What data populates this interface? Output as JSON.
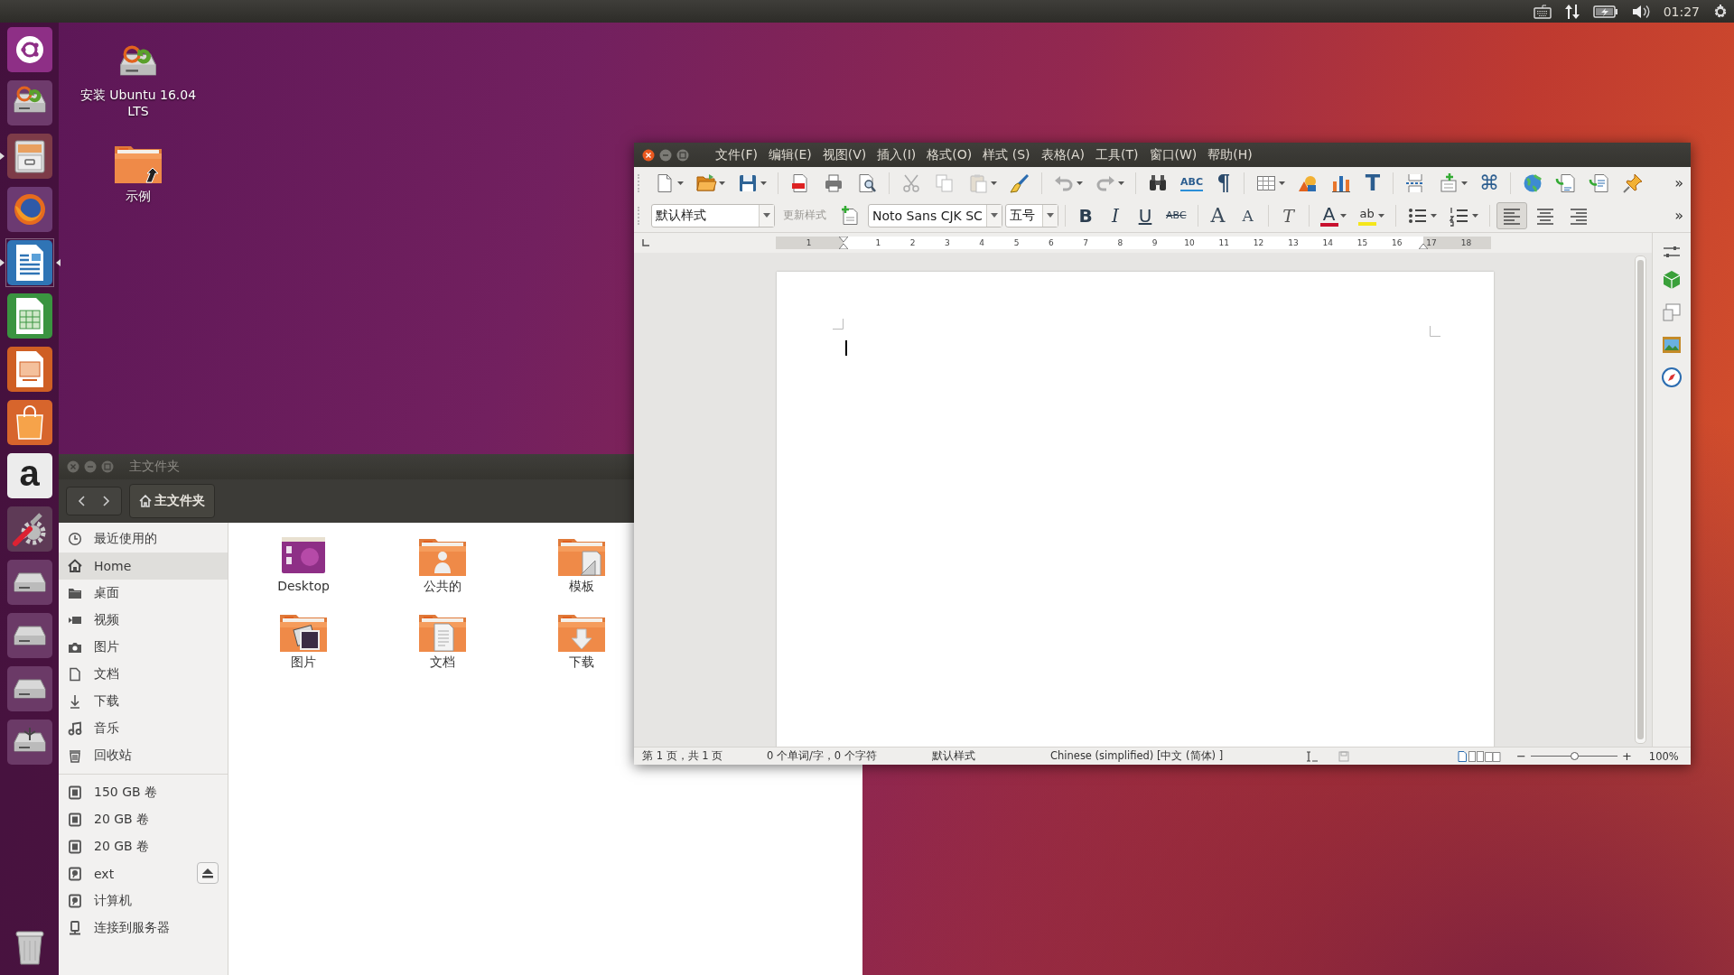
{
  "top_panel": {
    "clock": "01:27"
  },
  "launcher": {
    "items": [
      {
        "kind": "dash",
        "running": false,
        "focused": false
      },
      {
        "kind": "installer",
        "running": false,
        "focused": false
      },
      {
        "kind": "files",
        "running": true,
        "focused": false
      },
      {
        "kind": "browser",
        "running": false,
        "focused": false
      },
      {
        "kind": "writer",
        "running": true,
        "focused": true
      },
      {
        "kind": "calc",
        "running": false,
        "focused": false
      },
      {
        "kind": "impress",
        "running": false,
        "focused": false
      },
      {
        "kind": "software",
        "running": false,
        "focused": false
      },
      {
        "kind": "store",
        "glyph": "a",
        "running": false,
        "focused": false
      },
      {
        "kind": "settings",
        "running": false,
        "focused": false
      },
      {
        "kind": "drive",
        "running": false,
        "focused": false
      },
      {
        "kind": "drive",
        "running": false,
        "focused": false
      },
      {
        "kind": "drive",
        "running": false,
        "focused": false
      },
      {
        "kind": "usb-drive",
        "running": false,
        "focused": false
      },
      {
        "kind": "trash",
        "running": false,
        "focused": false
      }
    ]
  },
  "desktop_icons": [
    {
      "kind": "installer",
      "label": "安装 Ubuntu 16.04 LTS"
    },
    {
      "kind": "folder-link",
      "label": "示例"
    }
  ],
  "file_manager": {
    "title": "主文件夹",
    "path_button": "主文件夹",
    "places": [
      {
        "kind": "clock",
        "label": "最近使用的",
        "selected": false
      },
      {
        "kind": "home",
        "label": "Home",
        "selected": true
      },
      {
        "kind": "folder",
        "label": "桌面",
        "selected": false
      },
      {
        "kind": "video",
        "label": "视频",
        "selected": false
      },
      {
        "kind": "camera",
        "label": "图片",
        "selected": false
      },
      {
        "kind": "document",
        "label": "文档",
        "selected": false
      },
      {
        "kind": "download",
        "label": "下载",
        "selected": false
      },
      {
        "kind": "music",
        "label": "音乐",
        "selected": false
      },
      {
        "kind": "trash",
        "label": "回收站",
        "selected": false
      }
    ],
    "devices": [
      {
        "kind": "drive",
        "label": "150 GB 卷",
        "eject": false
      },
      {
        "kind": "drive",
        "label": "20 GB 卷",
        "eject": false
      },
      {
        "kind": "drive",
        "label": "20 GB 卷",
        "eject": false
      },
      {
        "kind": "disk",
        "label": "ext",
        "eject": true
      },
      {
        "kind": "disk",
        "label": "计算机",
        "eject": false
      },
      {
        "kind": "server",
        "label": "连接到服务器",
        "eject": false
      }
    ],
    "files": [
      {
        "kind": "desktop",
        "label": "Desktop"
      },
      {
        "kind": "public",
        "label": "公共的"
      },
      {
        "kind": "templates",
        "label": "模板"
      },
      {
        "kind": "pictures",
        "label": "图片"
      },
      {
        "kind": "documents",
        "label": "文档"
      },
      {
        "kind": "downloads",
        "label": "下载"
      }
    ]
  },
  "writer": {
    "menu": [
      "文件(F)",
      "编辑(E)",
      "视图(V)",
      "插入(I)",
      "格式(O)",
      "样式 (S)",
      "表格(A)",
      "工具(T)",
      "窗口(W)",
      "帮助(H)"
    ],
    "toolbar1": [
      {
        "kind": "new",
        "dropdown": true
      },
      {
        "kind": "open",
        "dropdown": true
      },
      {
        "kind": "save",
        "dropdown": true
      },
      {
        "kind": "separator"
      },
      {
        "kind": "pdf",
        "dropdown": false
      },
      {
        "kind": "print",
        "dropdown": false
      },
      {
        "kind": "preview",
        "dropdown": false
      },
      {
        "kind": "separator"
      },
      {
        "kind": "cut",
        "dropdown": false
      },
      {
        "kind": "copy",
        "dropdown": false
      },
      {
        "kind": "paste",
        "dropdown": true
      },
      {
        "kind": "clone",
        "dropdown": false
      },
      {
        "kind": "separator"
      },
      {
        "kind": "undo",
        "dropdown": true
      },
      {
        "kind": "redo",
        "dropdown": true
      },
      {
        "kind": "separator"
      },
      {
        "kind": "find",
        "dropdown": false
      },
      {
        "kind": "spell",
        "glyph": "ABC",
        "dropdown": false
      },
      {
        "kind": "marks",
        "glyph": "¶",
        "dropdown": false
      },
      {
        "kind": "separator"
      },
      {
        "kind": "table",
        "dropdown": true
      },
      {
        "kind": "shapes",
        "dropdown": false
      },
      {
        "kind": "chart",
        "dropdown": false
      },
      {
        "kind": "textbox",
        "glyph": "T",
        "dropdown": false
      },
      {
        "kind": "separator"
      },
      {
        "kind": "pagebreak",
        "dropdown": false
      },
      {
        "kind": "field",
        "dropdown": true
      },
      {
        "kind": "special",
        "glyph": "⌘",
        "dropdown": false
      },
      {
        "kind": "separator"
      },
      {
        "kind": "hyperlink",
        "dropdown": false
      },
      {
        "kind": "footnote",
        "dropdown": false
      },
      {
        "kind": "comment",
        "dropdown": false
      },
      {
        "kind": "track",
        "dropdown": false
      }
    ],
    "toolbar2": [
      {
        "kind": "style-combo",
        "value": "默认样式"
      },
      {
        "kind": "update-style",
        "label": "更新样式",
        "disabled": true
      },
      {
        "kind": "newstyle",
        "dropdown": false
      },
      {
        "kind": "font-combo",
        "value": "Noto Sans CJK SC"
      },
      {
        "kind": "size-combo",
        "value": "五号"
      },
      {
        "kind": "separator"
      },
      {
        "kind": "bold",
        "glyph": "B",
        "dropdown": false
      },
      {
        "kind": "italic",
        "glyph": "I",
        "dropdown": false
      },
      {
        "kind": "underline",
        "glyph": "U",
        "dropdown": false
      },
      {
        "kind": "strike",
        "glyph": "ABC",
        "dropdown": false
      },
      {
        "kind": "separator"
      },
      {
        "kind": "grow",
        "glyph": "A",
        "dropdown": false
      },
      {
        "kind": "shrink",
        "glyph": "A",
        "dropdown": false
      },
      {
        "kind": "separator"
      },
      {
        "kind": "clear",
        "glyph": "T",
        "dropdown": false
      },
      {
        "kind": "separator"
      },
      {
        "kind": "fontcolor",
        "glyph": "A",
        "dropdown": true
      },
      {
        "kind": "highlight",
        "glyph": "ab",
        "dropdown": true
      },
      {
        "kind": "separator"
      },
      {
        "kind": "bullets",
        "dropdown": true
      },
      {
        "kind": "numbering",
        "dropdown": true
      },
      {
        "kind": "separator"
      },
      {
        "kind": "alignleft",
        "selected": true
      },
      {
        "kind": "aligncenter",
        "selected": false
      },
      {
        "kind": "alignright",
        "selected": false
      }
    ],
    "overflow": "»",
    "ruler": [
      "1",
      "1",
      "2",
      "3",
      "4",
      "5",
      "6",
      "7",
      "8",
      "9",
      "10",
      "11",
      "12",
      "13",
      "14",
      "15",
      "16",
      "17",
      "18"
    ],
    "status_bar": {
      "page": "第 1 页，共 1 页",
      "words": "0 个单词/字，0 个字符",
      "style": "默认样式",
      "language": "Chinese (simplified) [中文 (简体) ]",
      "zoom_out": "−",
      "zoom_in": "+",
      "zoom": {
        "level": 0.5,
        "reading": "100%"
      }
    }
  }
}
